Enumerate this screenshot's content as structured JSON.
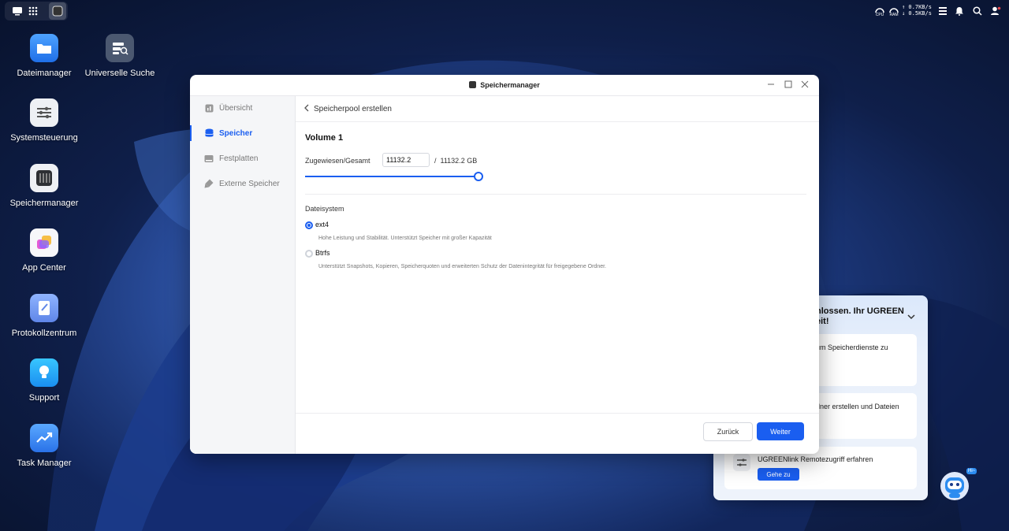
{
  "desktop": {
    "icons": [
      {
        "label": "Dateimanager"
      },
      {
        "label": "Universelle Suche"
      },
      {
        "label": "Systemsteuerung"
      },
      {
        "label": "Speichermanager"
      },
      {
        "label": "App Center"
      },
      {
        "label": "Protokollzentrum"
      },
      {
        "label": "Support"
      },
      {
        "label": "Task Manager"
      }
    ]
  },
  "topbar": {
    "cpu_label": "CPU",
    "ram_label": "RAM",
    "upload": "↑ 0.7KB/s",
    "download": "↓ 0.5KB/s"
  },
  "window": {
    "title": "Speichermanager",
    "sidebar": [
      {
        "label": "Übersicht"
      },
      {
        "label": "Speicher"
      },
      {
        "label": "Festplatten"
      },
      {
        "label": "Externe Speicher"
      }
    ],
    "breadcrumb": "Speicherpool erstellen",
    "volume_title": "Volume 1",
    "alloc_label": "Zugewiesen/Gesamt",
    "alloc_value": "11132.2",
    "total_text": "/  11132.2 GB",
    "slider_fraction": 1.0,
    "fs_label": "Dateisystem",
    "options": [
      {
        "label": "ext4",
        "desc": "Hohe Leistung und Stabilität. Unterstützt Speicher mit großer Kapazität",
        "selected": true
      },
      {
        "label": "Btrfs",
        "desc": "Unterstützt Snapshots, Kopieren, Speicherquoten und erweiterten Schutz der Datenintegrität für freigegebene Ordner.",
        "selected": false
      }
    ],
    "back_label": "Zurück",
    "next_label": "Weiter"
  },
  "assistant": {
    "heading_line1": "hlossen. Ihr UGREEN",
    "heading_line2": "eit!",
    "card1": "um Speicherdienste zu",
    "card2": "dner erstellen und Dateien",
    "card3": "UGREENlink Remotezugriff erfahren",
    "goto_label": "Gehe zu",
    "bot_badge": "Hi~"
  },
  "colors": {
    "accent": "#1a5ef0"
  }
}
